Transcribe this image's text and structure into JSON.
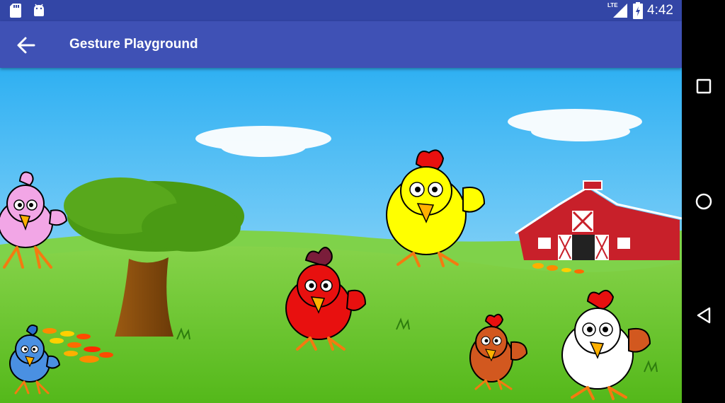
{
  "status_bar": {
    "time": "4:42",
    "network": "LTE",
    "icons": [
      "sd-card-icon",
      "android-icon",
      "lte-signal-icon",
      "battery-charging-icon"
    ]
  },
  "app_bar": {
    "title": "Gesture Playground",
    "back_icon": "arrow-back-icon"
  },
  "scene": {
    "sky_color": "#3fb8f0",
    "grass_color": "#5bbf1f",
    "chickens": [
      {
        "name": "pink-chicken",
        "color": "#f2a6e6"
      },
      {
        "name": "blue-chicken",
        "color": "#4a90e2"
      },
      {
        "name": "red-chicken",
        "color": "#e8100f"
      },
      {
        "name": "yellow-chicken",
        "color": "#ffff00"
      },
      {
        "name": "brown-chicken",
        "color": "#d2581f"
      },
      {
        "name": "white-chicken",
        "color": "#ffffff"
      }
    ]
  },
  "nav_bar": {
    "buttons": [
      "recents-square-icon",
      "home-circle-icon",
      "back-triangle-icon"
    ]
  }
}
